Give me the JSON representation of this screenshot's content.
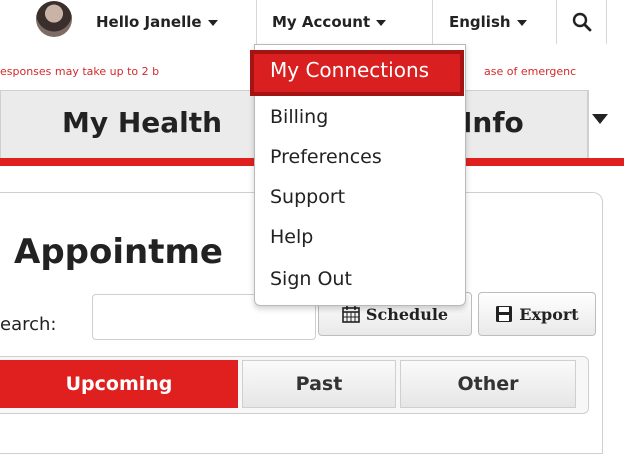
{
  "topbar": {
    "greeting": "Hello Janelle",
    "account_label": "My Account",
    "language_label": "English",
    "search_icon": "search-icon"
  },
  "notice": {
    "left_text": "esponses may take up to 2 b",
    "right_text": "ase of emergenc"
  },
  "tabs": {
    "title_left": "My Health",
    "title_right": "Info"
  },
  "page": {
    "title": "Appointme",
    "search_label": "earch:",
    "search_value": "",
    "schedule_label": "Schedule",
    "export_label": "Export"
  },
  "segments": [
    "Upcoming",
    "Past",
    "Other"
  ],
  "dropdown": {
    "items": [
      "My Connections",
      "Billing",
      "Preferences",
      "Support",
      "Help",
      "Sign Out"
    ],
    "highlighted": "My Connections"
  },
  "colors": {
    "brand_red": "#e0201f",
    "notice_red": "#d42a2a"
  }
}
